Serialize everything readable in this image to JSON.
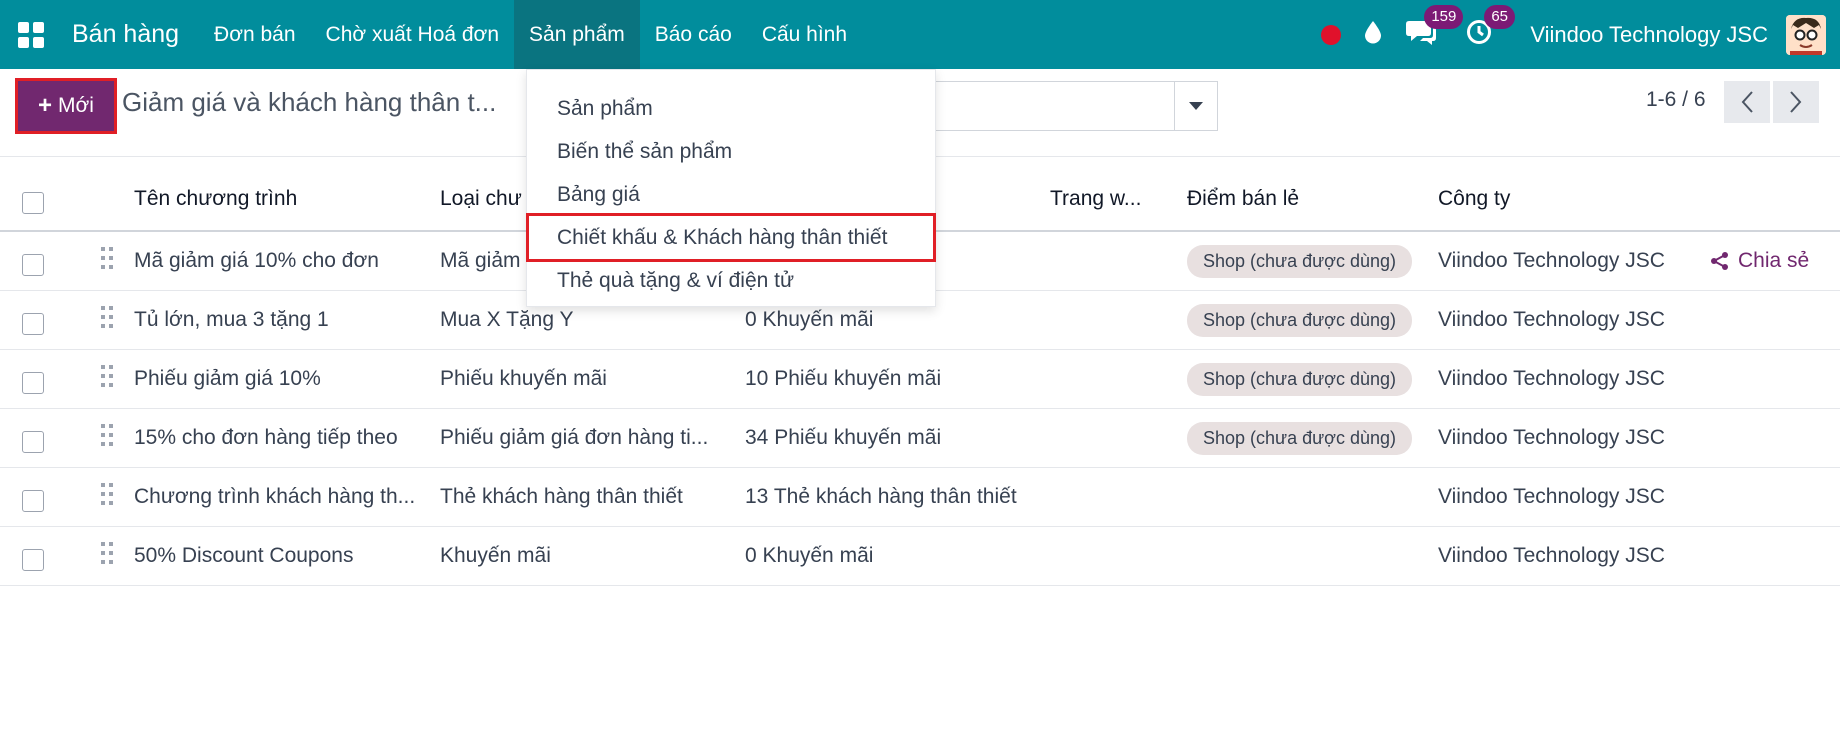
{
  "navbar": {
    "app_name": "Bán hàng",
    "menu": [
      "Đơn bán",
      "Chờ xuất Hoá đơn",
      "Sản phẩm",
      "Báo cáo",
      "Cấu hình"
    ],
    "active_menu": "Sản phẩm",
    "chat_count": "159",
    "activity_count": "65",
    "company": "Viindoo Technology JSC"
  },
  "control": {
    "new_label": "Mới",
    "breadcrumb": "Giảm giá và khách hàng thân t...",
    "pager": "1-6 / 6"
  },
  "dropdown": {
    "items": [
      "Sản phẩm",
      "Biến thể sản phẩm",
      "Bảng giá",
      "Chiết khấu & Khách hàng thân thiết",
      "Thẻ quà tặng & ví điện tử"
    ],
    "highlighted_index": 3
  },
  "table": {
    "columns": [
      "Tên chương trình",
      "Loại chư",
      "",
      "Trang w...",
      "Điểm bán lẻ",
      "Công ty"
    ],
    "share_label": "Chia sẻ",
    "rows": [
      {
        "name": "Mã giảm giá 10% cho đơn",
        "type": "Mã giảm",
        "count": "",
        "pos": "Shop (chưa được dùng)",
        "company": "Viindoo Technology JSC"
      },
      {
        "name": "Tủ lớn, mua 3 tặng 1",
        "type": "Mua X Tặng Y",
        "count": "0 Khuyến mãi",
        "pos": "Shop (chưa được dùng)",
        "company": "Viindoo Technology JSC"
      },
      {
        "name": "Phiếu giảm giá 10%",
        "type": "Phiếu khuyến mãi",
        "count": "10 Phiếu khuyến mãi",
        "pos": "Shop (chưa được dùng)",
        "company": "Viindoo Technology JSC"
      },
      {
        "name": "15% cho đơn hàng tiếp theo",
        "type": "Phiếu giảm giá đơn hàng ti...",
        "count": "34 Phiếu khuyến mãi",
        "pos": "Shop (chưa được dùng)",
        "company": "Viindoo Technology JSC"
      },
      {
        "name": "Chương trình khách hàng th...",
        "type": "Thẻ khách hàng thân thiết",
        "count": "13 Thẻ khách hàng thân thiết",
        "pos": "",
        "company": "Viindoo Technology JSC"
      },
      {
        "name": "50% Discount Coupons",
        "type": "Khuyến mãi",
        "count": "0 Khuyến mãi",
        "pos": "",
        "company": "Viindoo Technology JSC"
      }
    ]
  }
}
